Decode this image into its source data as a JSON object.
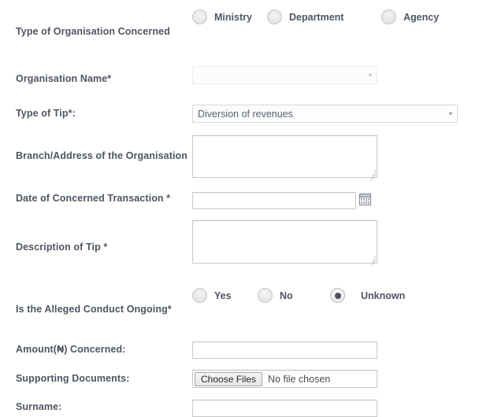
{
  "form": {
    "rows": [
      {
        "label": "Type of Organisation Concerned",
        "type": "radio",
        "options": [
          {
            "label": "Ministry",
            "checked": false
          },
          {
            "label": "Department",
            "checked": false
          },
          {
            "label": "Agency",
            "checked": false
          }
        ]
      },
      {
        "label": "Organisation Name*",
        "type": "select",
        "value": "",
        "caret": "▾"
      },
      {
        "label": "Type of Tip*:",
        "type": "select",
        "value": "Diversion of revenues",
        "caret": "▾"
      },
      {
        "label": "Branch/Address of the Organisation",
        "type": "textarea",
        "value": ""
      },
      {
        "label": "Date of Concerned Transaction *",
        "type": "date",
        "value": "",
        "icon": "calendar-icon"
      },
      {
        "label": "Description of Tip *",
        "type": "textarea",
        "value": ""
      },
      {
        "label": "Is the Alleged Conduct Ongoing*",
        "type": "radio",
        "options": [
          {
            "label": "Yes",
            "checked": false
          },
          {
            "label": "No",
            "checked": false
          },
          {
            "label": "Unknown",
            "checked": true
          }
        ]
      },
      {
        "label": "Amount(₦) Concerned:",
        "type": "text",
        "value": ""
      },
      {
        "label": "Supporting Documents:",
        "type": "file",
        "button_label": "Choose Files",
        "file_status": "No file chosen"
      },
      {
        "label": "Surname:",
        "type": "text",
        "value": ""
      }
    ]
  },
  "colors": {
    "label": "#4e5663",
    "input_border": "#c9c9c9",
    "radio_dot": "#4a5260",
    "page_bg": "#ffffff"
  }
}
